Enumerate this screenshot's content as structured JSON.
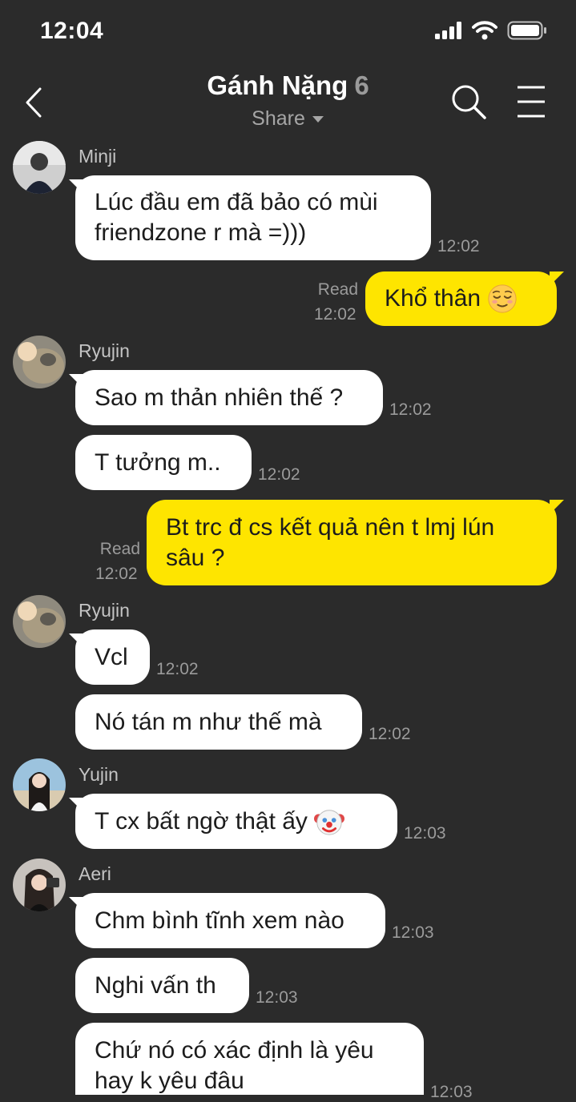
{
  "status_bar": {
    "time": "12:04"
  },
  "header": {
    "title": "Gánh Nặng",
    "member_count": "6",
    "share_label": "Share"
  },
  "messages": [
    {
      "sender": "Minji",
      "text": "Lúc đầu em đã bảo có mùi\nfriendzone r mà =)))",
      "time": "12:02"
    },
    {
      "read": "Read",
      "time": "12:02",
      "text": "Khổ thân",
      "emoji": "relieved-face"
    },
    {
      "sender": "Ryujin",
      "text": "Sao m thản nhiên thế ?",
      "time": "12:02"
    },
    {
      "text": "T tưởng m..",
      "time": "12:02"
    },
    {
      "read": "Read",
      "time": "12:02",
      "text": "Bt trc đ cs kết quả nên t lmj lún\nsâu ?"
    },
    {
      "sender": "Ryujin",
      "text": "Vcl",
      "time": "12:02"
    },
    {
      "text": "Nó tán m như thế mà",
      "time": "12:02"
    },
    {
      "sender": "Yujin",
      "text": "T cx bất ngờ thật ấy",
      "emoji": "clown-face",
      "time": "12:03"
    },
    {
      "sender": "Aeri",
      "text": "Chm bình tĩnh xem nào",
      "time": "12:03"
    },
    {
      "text": "Nghi vấn th",
      "time": "12:03"
    },
    {
      "text": "Chứ nó có xác định là yêu\nhay k yêu đâu",
      "time": "12:03"
    }
  ],
  "colors": {
    "background": "#2b2b2b",
    "incoming_bubble": "#ffffff",
    "outgoing_bubble": "#fee500",
    "meta_text": "#9b9b9b"
  }
}
